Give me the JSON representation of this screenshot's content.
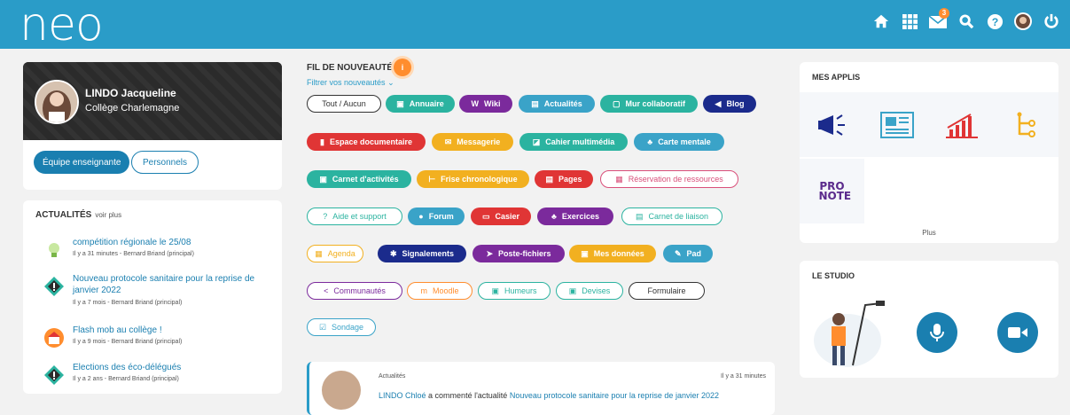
{
  "app": {
    "logo": "neo",
    "notifications_count": "3"
  },
  "top_icons": [
    "home-icon",
    "apps-grid-icon",
    "mail-icon",
    "search-icon",
    "help-icon",
    "user-avatar",
    "power-icon"
  ],
  "profile": {
    "name": "LINDO Jacqueline",
    "school": "Collège Charlemagne",
    "btn_team": "Équipe enseignante",
    "btn_staff": "Personnels"
  },
  "news": {
    "title": "ACTUALITÉS",
    "see_more": "voir plus",
    "items": [
      {
        "title": "compétition régionale le 25/08",
        "meta": "Il y a 31 minutes - Bernard Briand (principal)"
      },
      {
        "title": "Nouveau protocole sanitaire pour la reprise de janvier 2022",
        "meta": "Il y a 7 mois - Bernard Briand (principal)"
      },
      {
        "title": "Flash mob au collège !",
        "meta": "Il y a 9 mois - Bernard Briand (principal)"
      },
      {
        "title": "Elections des éco-délégués",
        "meta": "Il y a 2 ans - Bernard Briand (principal)"
      }
    ]
  },
  "feed": {
    "title": "FIL DE NOUVEAUTÉS",
    "badge": "i",
    "filter": "Filtrer vos nouveautés",
    "chips": [
      {
        "label": "Tout / Aucun",
        "icon": "",
        "color": "#333333",
        "style": "outline"
      },
      {
        "label": "Annuaire",
        "icon": "▣",
        "color": "#2bb3a0",
        "style": "filled"
      },
      {
        "label": "Wiki",
        "icon": "W",
        "color": "#7b2a9c",
        "style": "filled"
      },
      {
        "label": "Actualités",
        "icon": "▤",
        "color": "#3aa3c8",
        "style": "filled"
      },
      {
        "label": "Mur collaboratif",
        "icon": "▢",
        "color": "#2bb3a0",
        "style": "filled"
      },
      {
        "label": "Blog",
        "icon": "◀",
        "color": "#1b2b8c",
        "style": "filled"
      },
      {
        "label": "Espace documentaire",
        "icon": "▮",
        "color": "#e03535",
        "style": "filled"
      },
      {
        "label": "Messagerie",
        "icon": "✉",
        "color": "#f2b020",
        "style": "filled"
      },
      {
        "label": "Cahier multimédia",
        "icon": "◪",
        "color": "#2bb3a0",
        "style": "filled"
      },
      {
        "label": "Carte mentale",
        "icon": "♣",
        "color": "#3aa3c8",
        "style": "filled"
      },
      {
        "label": "Carnet d'activités",
        "icon": "▣",
        "color": "#2bb3a0",
        "style": "filled"
      },
      {
        "label": "Frise chronologique",
        "icon": "⊢",
        "color": "#f2b020",
        "style": "filled"
      },
      {
        "label": "Pages",
        "icon": "▤",
        "color": "#e03535",
        "style": "filled"
      },
      {
        "label": "Réservation de ressources",
        "icon": "▦",
        "color": "#d94f7a",
        "style": "outline"
      },
      {
        "label": "Aide et support",
        "icon": "?",
        "color": "#2bb3a0",
        "style": "outline"
      },
      {
        "label": "Forum",
        "icon": "●",
        "color": "#3aa3c8",
        "style": "filled"
      },
      {
        "label": "Casier",
        "icon": "▭",
        "color": "#e03535",
        "style": "filled"
      },
      {
        "label": "Exercices",
        "icon": "♣",
        "color": "#7b2a9c",
        "style": "filled"
      },
      {
        "label": "Carnet de liaison",
        "icon": "▤",
        "color": "#2bb3a0",
        "style": "outline"
      },
      {
        "label": "Agenda",
        "icon": "▦",
        "color": "#f2b020",
        "style": "outline"
      },
      {
        "label": "Signalements",
        "icon": "✱",
        "color": "#1b2b8c",
        "style": "filled"
      },
      {
        "label": "Poste-fichiers",
        "icon": "➤",
        "color": "#7b2a9c",
        "style": "filled"
      },
      {
        "label": "Mes données",
        "icon": "▣",
        "color": "#f2b020",
        "style": "filled"
      },
      {
        "label": "Pad",
        "icon": "✎",
        "color": "#3aa3c8",
        "style": "filled"
      },
      {
        "label": "Communautés",
        "icon": "<",
        "color": "#7b2a9c",
        "style": "outline"
      },
      {
        "label": "Moodle",
        "icon": "m",
        "color": "#ff8d2e",
        "style": "outline"
      },
      {
        "label": "Humeurs",
        "icon": "▣",
        "color": "#2bb3a0",
        "style": "outline"
      },
      {
        "label": "Devises",
        "icon": "▣",
        "color": "#2bb3a0",
        "style": "outline"
      },
      {
        "label": "Formulaire",
        "icon": "",
        "color": "#333333",
        "style": "outline"
      },
      {
        "label": "Sondage",
        "icon": "☑",
        "color": "#3aa3c8",
        "style": "outline"
      }
    ]
  },
  "post": {
    "type": "Actualités",
    "time": "Il y a 31 minutes",
    "author": "LINDO Chloé",
    "action": "a commenté l'actualité",
    "link": "Nouveau protocole sanitaire pour la reprise de janvier 2022"
  },
  "apps": {
    "title": "MES APPLIS",
    "items": [
      "megaphone-icon",
      "news-icon",
      "chart-icon",
      "timeline-icon",
      "pronote-logo"
    ],
    "pronote_text": "PRO NOTE",
    "more": "Plus"
  },
  "studio": {
    "title": "LE STUDIO",
    "buttons": [
      "microphone-button",
      "video-button"
    ]
  }
}
